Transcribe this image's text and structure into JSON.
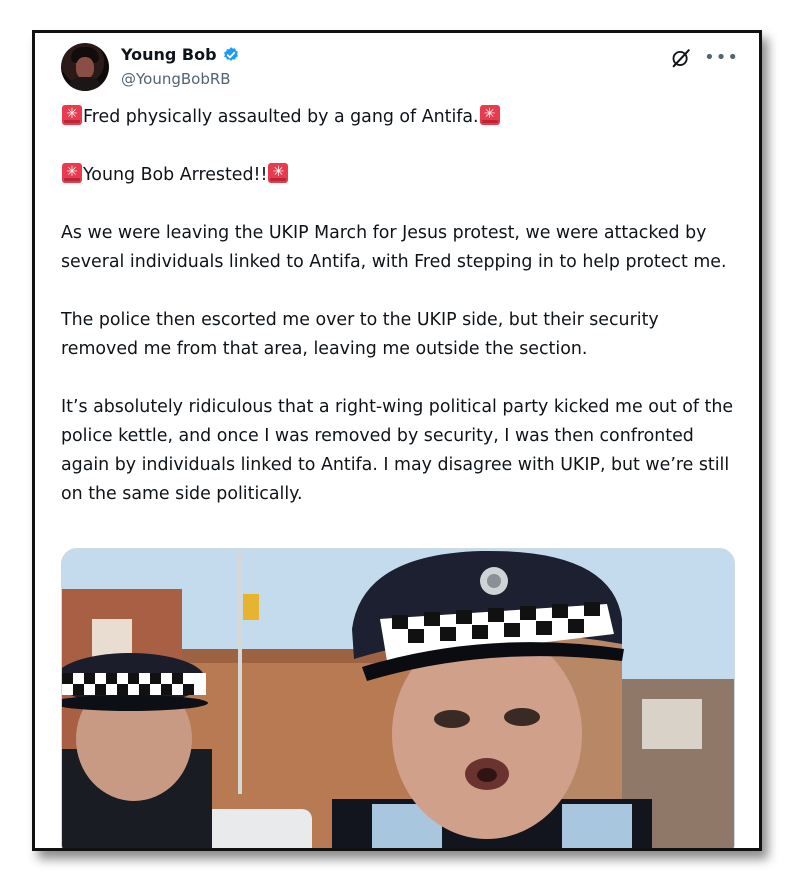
{
  "tweet": {
    "author_name": "Young Bob",
    "author_handle": "@YoungBobRB",
    "line1": "Fred physically assaulted by a gang of Antifa.",
    "line2": "Young Bob Arrested!!",
    "para1": "As we were leaving the UKIP March for Jesus protest, we were attacked by several individuals linked to Antifa, with Fred stepping in to help protect me.",
    "para2": "The police then escorted me over to the UKIP side, but their security removed me from that area, leaving me outside the section.",
    "para3": "It’s absolutely ridiculous that a right-wing political party kicked me out of the police kettle, and once I was removed by security, I was then confronted again by individuals linked to Antifa. I may disagree with UKIP, but we’re still on the same side politically.",
    "icons": {
      "verified": "verified-badge-icon",
      "grok": "grok-icon",
      "more": "more-icon",
      "siren": "police-siren-emoji-icon"
    },
    "colors": {
      "verified": "#1d9bf0",
      "siren": "#e83b4d",
      "handle": "#536471"
    }
  }
}
